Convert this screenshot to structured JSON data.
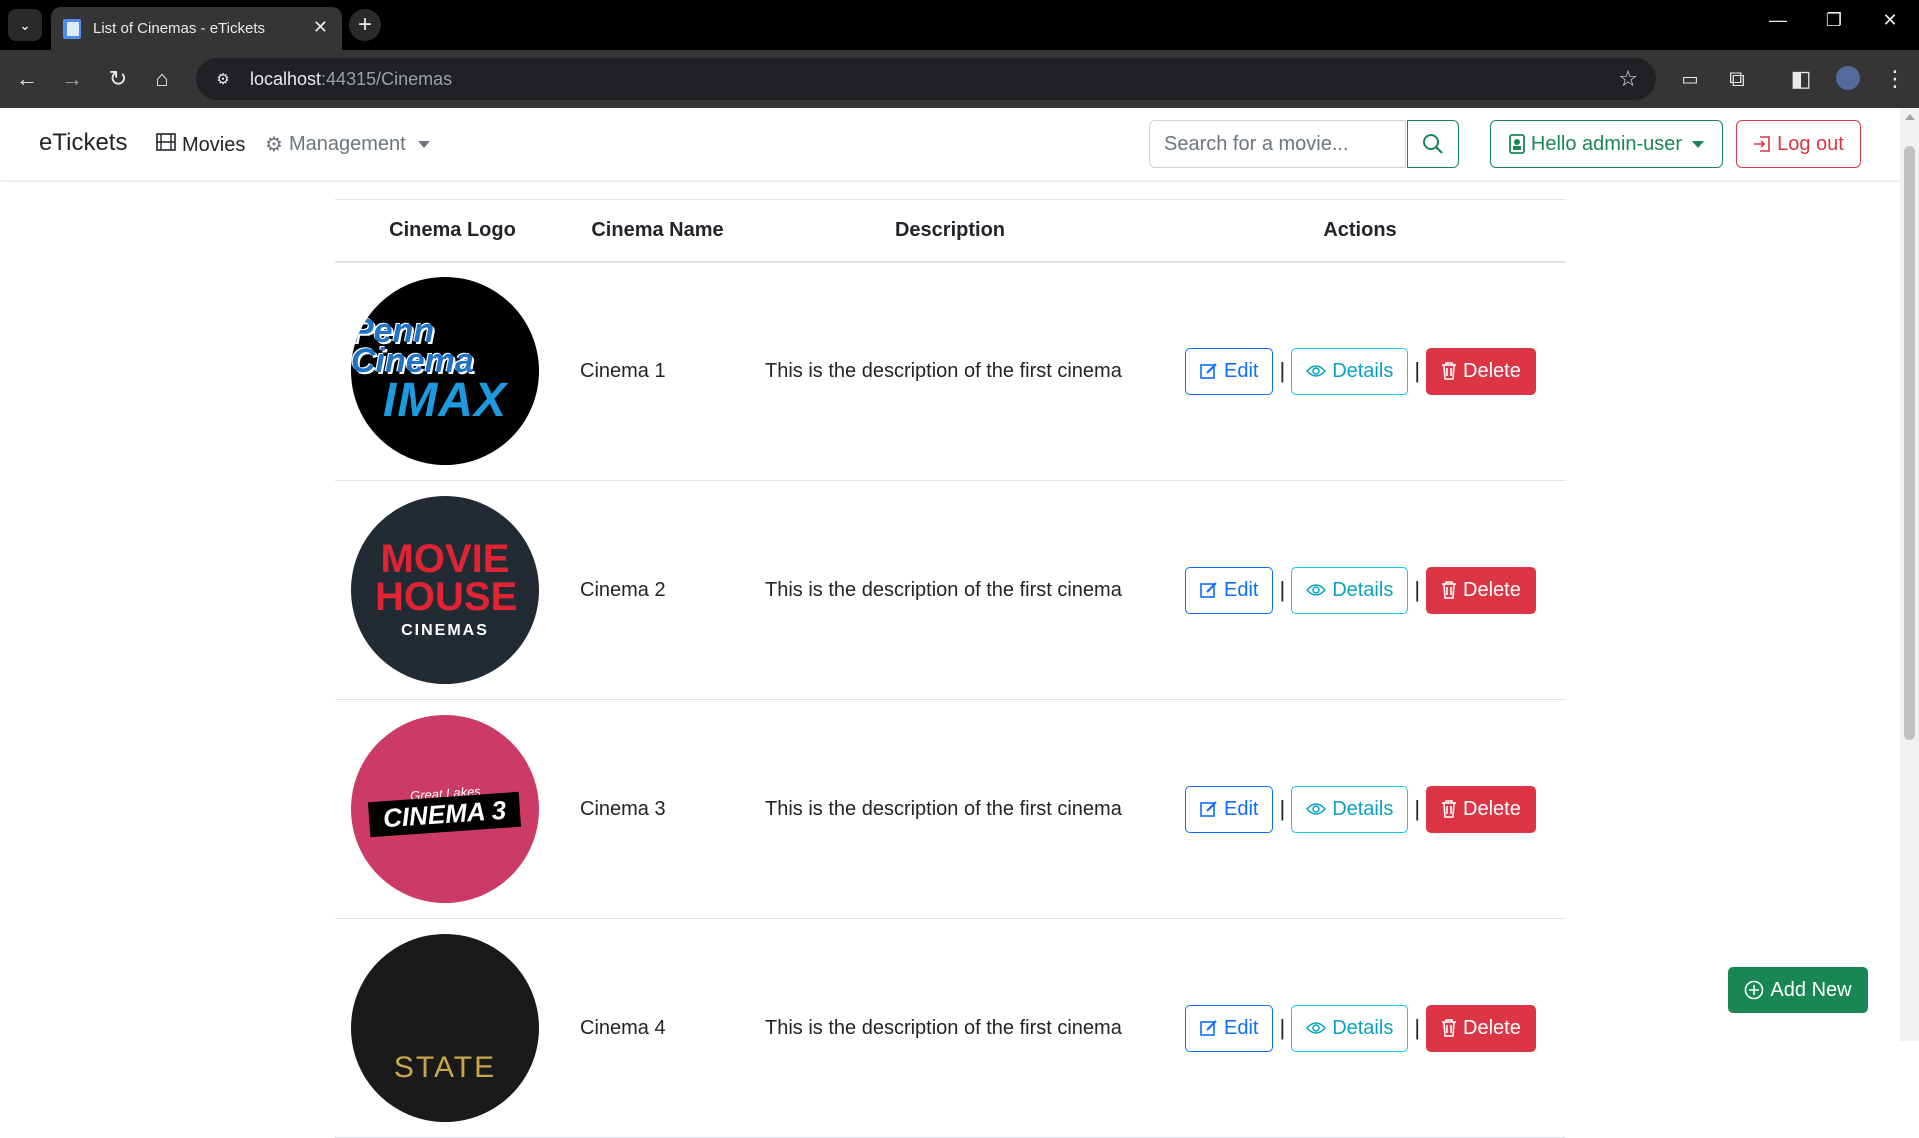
{
  "browser": {
    "tab_title": "List of Cinemas - eTickets",
    "tab_close": "✕",
    "new_tab": "+",
    "url_host": "localhost",
    "url_rest": ":44315/Cinemas"
  },
  "navbar": {
    "brand": "eTickets",
    "movies_label": "Movies",
    "management_label": "Management",
    "search_placeholder": "Search for a movie...",
    "user_label": "Hello admin-user",
    "logout_label": "Log out"
  },
  "table": {
    "headers": [
      "Cinema Logo",
      "Cinema Name",
      "Description",
      "Actions"
    ],
    "rows": [
      {
        "name": "Cinema 1",
        "description": "This is the description of the first cinema",
        "logo_text_1": "Penn Cinema",
        "logo_text_2": "IMAX"
      },
      {
        "name": "Cinema 2",
        "description": "This is the description of the first cinema",
        "logo_text_1": "MOVIE HOUSE",
        "logo_text_2": "CINEMAS"
      },
      {
        "name": "Cinema 3",
        "description": "This is the description of the first cinema",
        "logo_text_1": "Great Lakes",
        "logo_text_2": "CINEMA 3"
      },
      {
        "name": "Cinema 4",
        "description": "This is the description of the first cinema",
        "logo_text_1": "STATE"
      }
    ],
    "actions": {
      "edit": "Edit",
      "details": "Details",
      "delete": "Delete",
      "separator": "|"
    }
  },
  "add_new_label": "Add New",
  "colors": {
    "primary": "#0d6efd",
    "info": "#0dcaf0",
    "danger": "#dc3545",
    "success": "#198754"
  }
}
